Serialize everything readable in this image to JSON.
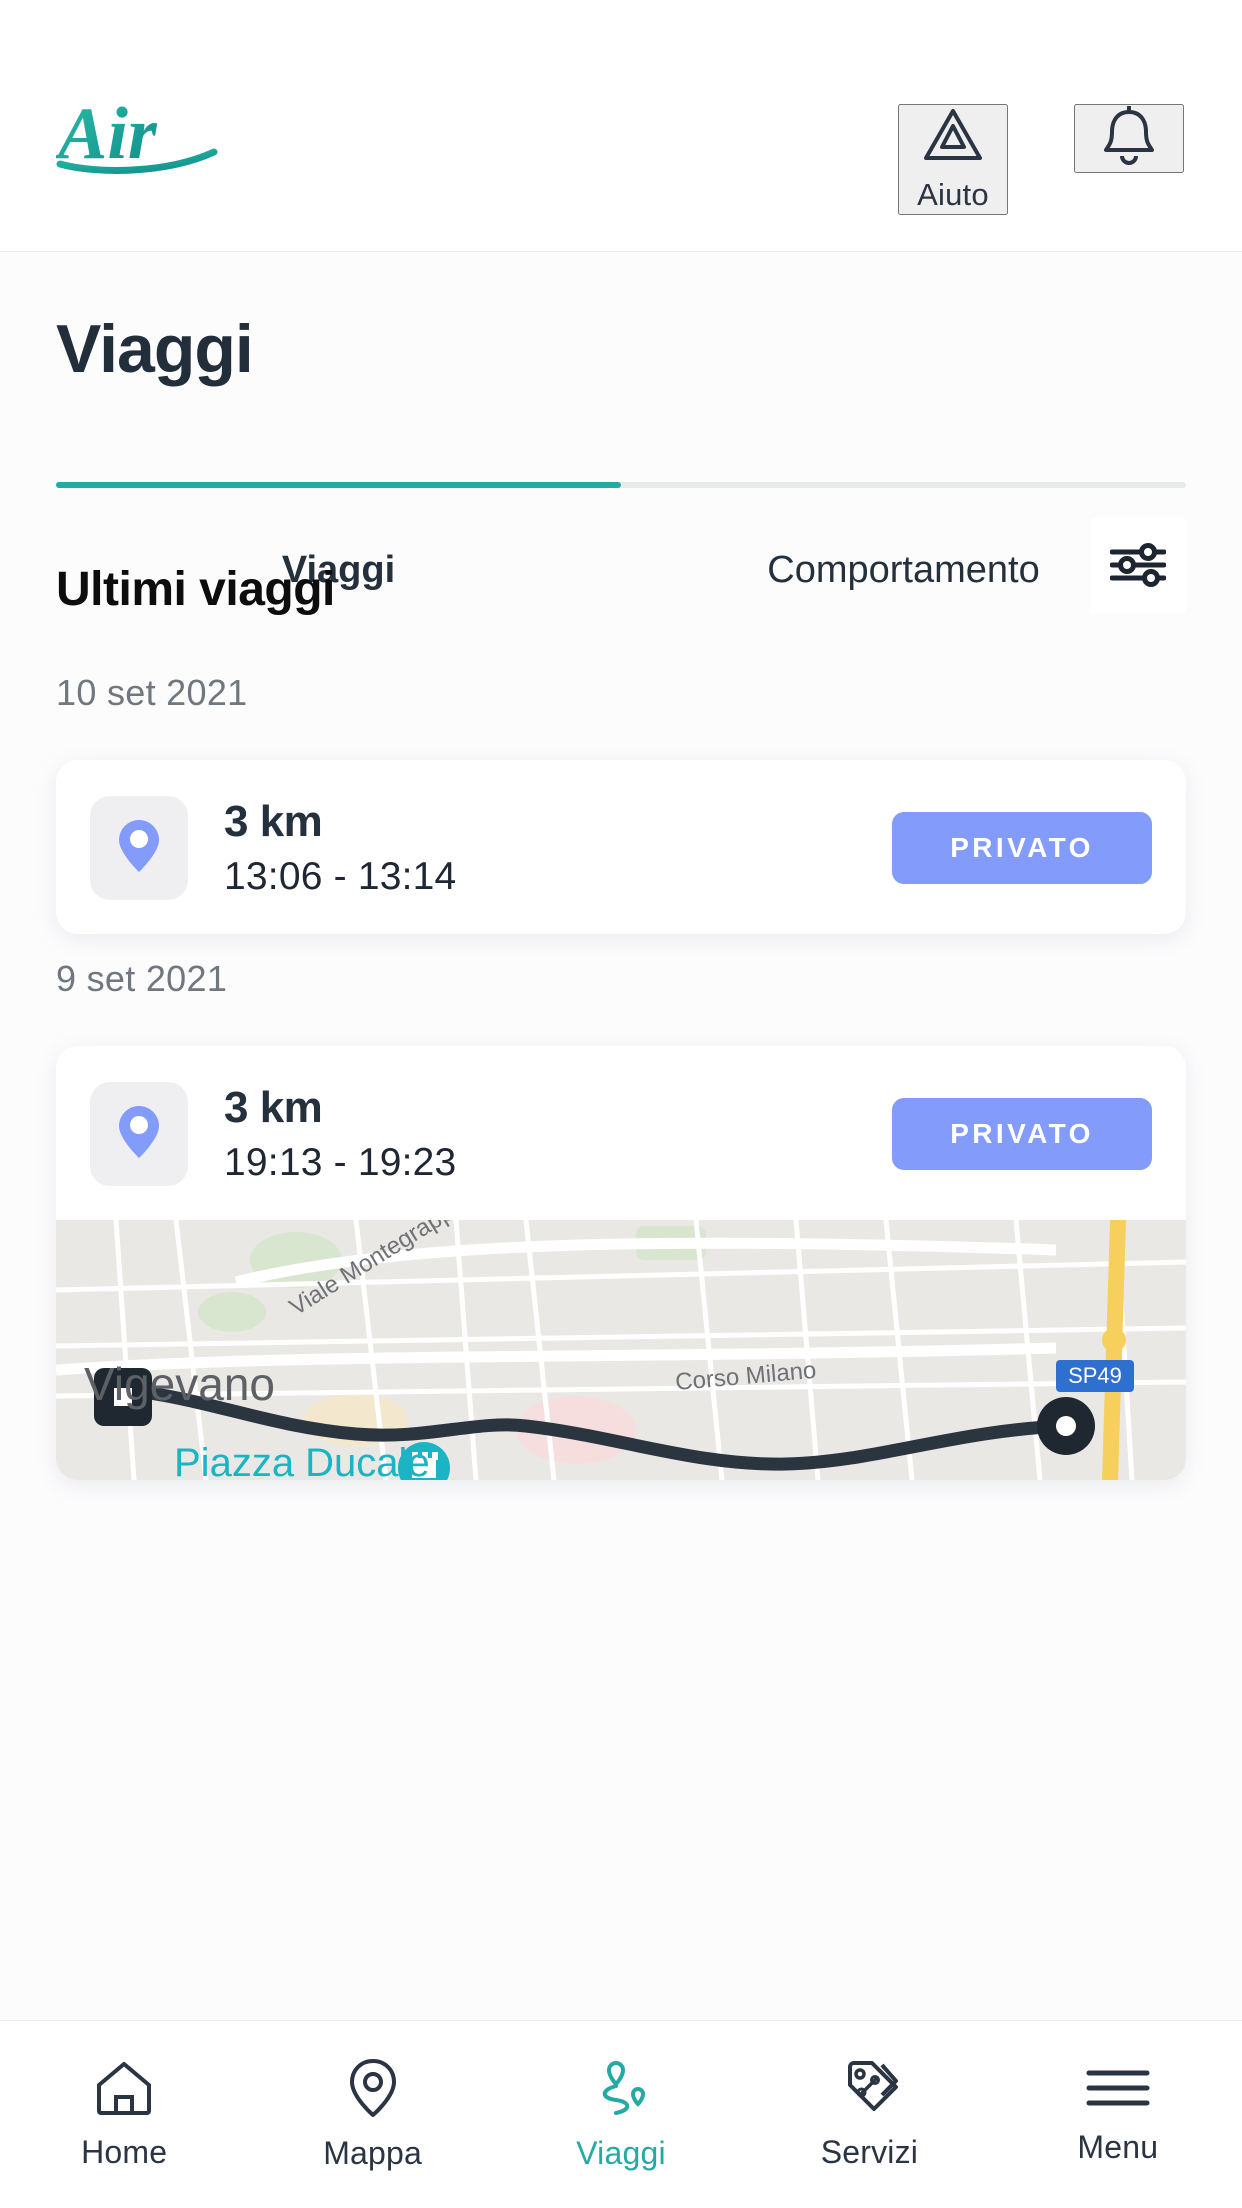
{
  "brand": {
    "logo_text": "Air",
    "logo_color": "#179e93"
  },
  "appbar": {
    "help_label": "Aiuto",
    "help_icon": "warning-triangle-icon",
    "notifications_icon": "bell-icon"
  },
  "page": {
    "title": "Viaggi"
  },
  "tabs": {
    "items": [
      {
        "label": "Viaggi",
        "active": true
      },
      {
        "label": "Comportamento",
        "active": false
      }
    ],
    "active_color": "#25a9a5",
    "track_color": "#e8eaea"
  },
  "section": {
    "title": "Ultimi viaggi",
    "filter_icon": "filter-sliders-icon"
  },
  "groups": [
    {
      "date": "10 set 2021",
      "trips": [
        {
          "distance": "3 km",
          "time_range": "13:06 - 13:14",
          "tag_label": "PRIVATO",
          "tag_color": "#839bfb",
          "pin_icon": "map-pin-icon",
          "has_map": false
        }
      ]
    },
    {
      "date": "9 set 2021",
      "trips": [
        {
          "distance": "3 km",
          "time_range": "19:13 - 19:23",
          "tag_label": "PRIVATO",
          "tag_color": "#839bfb",
          "pin_icon": "map-pin-icon",
          "has_map": true
        }
      ]
    }
  ],
  "map": {
    "city_label": "Vigevano",
    "street_labels": [
      "Viale Montegrappa",
      "Corso Milano"
    ],
    "place_label": "Piazza Ducale",
    "road_shield": "SP49",
    "start_marker": "square-start-marker",
    "end_marker": "circle-end-marker",
    "poi_icon": "castle-icon",
    "land_color": "#eae8e4",
    "route_color": "#2b3540",
    "highway_color": "#f7cf5d"
  },
  "bottomnav": {
    "items": [
      {
        "label": "Home",
        "icon": "home-icon",
        "active": false
      },
      {
        "label": "Mappa",
        "icon": "pin-icon",
        "active": false
      },
      {
        "label": "Viaggi",
        "icon": "route-icon",
        "active": true
      },
      {
        "label": "Servizi",
        "icon": "tags-icon",
        "active": false
      },
      {
        "label": "Menu",
        "icon": "hamburger-icon",
        "active": false
      }
    ],
    "active_color": "#25a9a5"
  }
}
